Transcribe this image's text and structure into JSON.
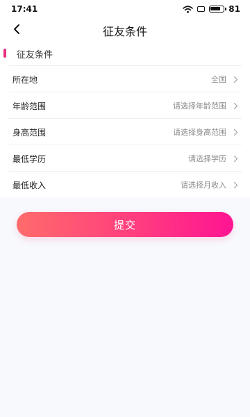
{
  "status_bar": {
    "time": "17:41",
    "battery": "81"
  },
  "nav": {
    "title": "征友条件",
    "back_icon": "chevron-left-icon"
  },
  "section": {
    "title": "征友条件",
    "marker_color": "#e8307f"
  },
  "rows": [
    {
      "label": "所在地",
      "value": "全国"
    },
    {
      "label": "年龄范围",
      "value": "请选择年龄范围"
    },
    {
      "label": "身高范围",
      "value": "请选择身高范围"
    },
    {
      "label": "最低学历",
      "value": "请选择学历"
    },
    {
      "label": "最低收入",
      "value": "请选择月收入"
    }
  ],
  "submit": {
    "label": "提交",
    "gradient": [
      "#ff6b6b",
      "#ff1493"
    ]
  }
}
